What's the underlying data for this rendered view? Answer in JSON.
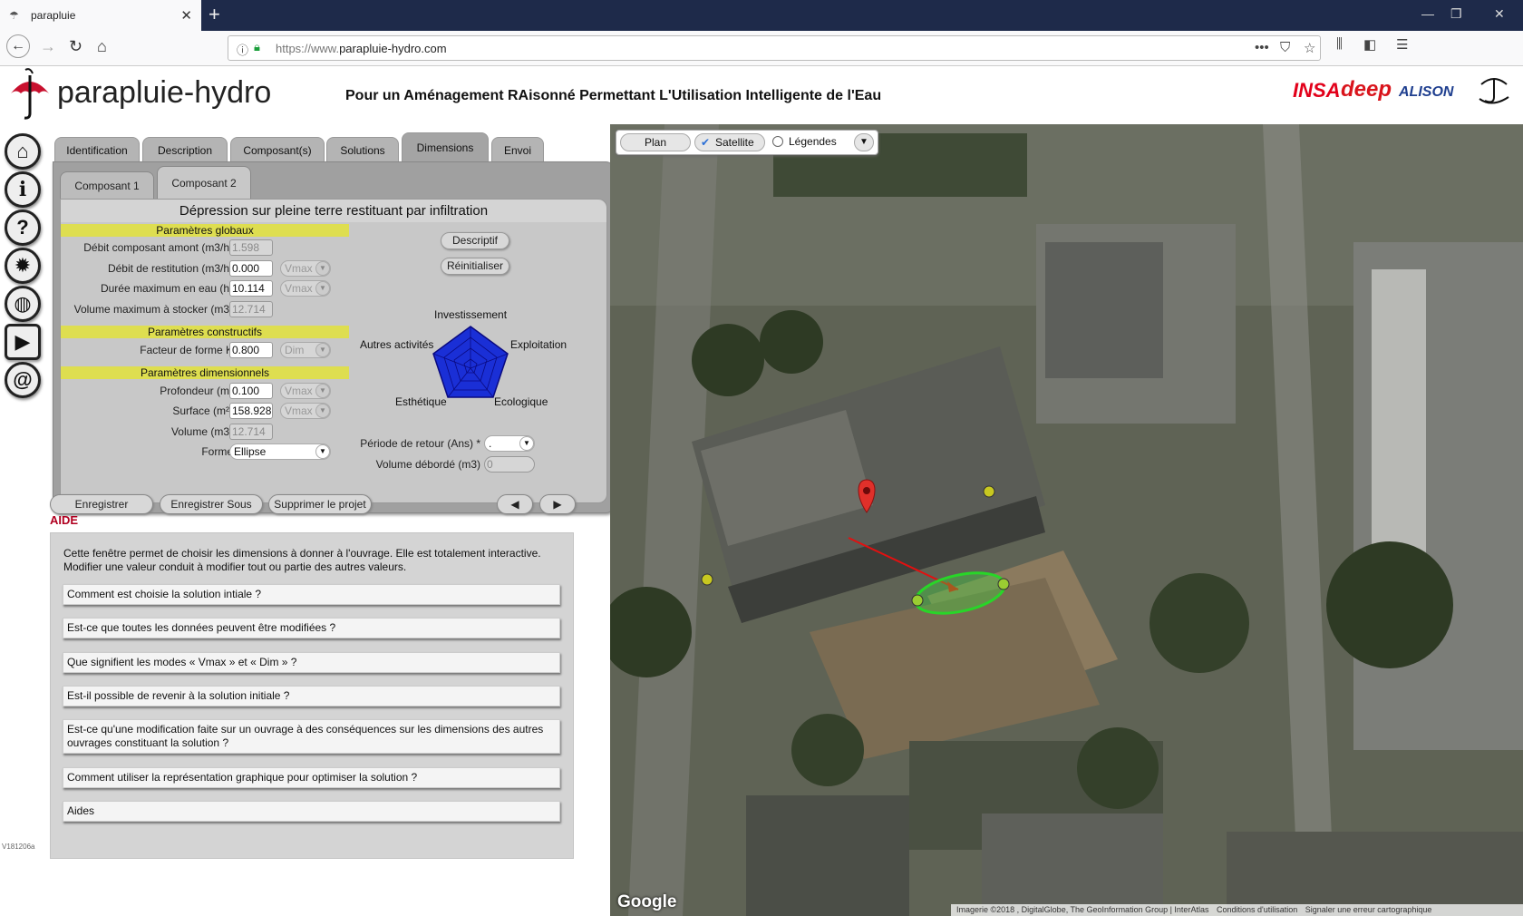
{
  "browser": {
    "tab_title": "parapluie",
    "url_prefix": "https://www.",
    "url_domain": "parapluie-hydro.com"
  },
  "header": {
    "app_title": "parapluie-hydro",
    "tagline": "Pour un Aménagement RAisonné Permettant L'Utilisation Intelligente de l'Eau",
    "partners": [
      "INSA",
      "deep",
      "ALISON"
    ]
  },
  "sidebar": {
    "icons": [
      "home-icon",
      "info-icon",
      "help-icon",
      "lightbulb-icon",
      "globe-icon",
      "video-icon",
      "at-icon"
    ]
  },
  "tabs": [
    {
      "label": "Identification",
      "active": false
    },
    {
      "label": "Description",
      "active": false
    },
    {
      "label": "Composant(s)",
      "active": false
    },
    {
      "label": "Solutions",
      "active": false
    },
    {
      "label": "Dimensions",
      "active": true
    },
    {
      "label": "Envoi",
      "active": false
    }
  ],
  "subtabs": [
    {
      "label": "Composant 1",
      "active": false
    },
    {
      "label": "Composant 2",
      "active": true
    }
  ],
  "form": {
    "title": "Dépression sur pleine terre restituant par infiltration",
    "sections": {
      "global": "Paramètres globaux",
      "constructive": "Paramètres constructifs",
      "dimensional": "Paramètres dimensionnels"
    },
    "fields": {
      "debit_amont": {
        "label": "Débit composant amont (m3/h)",
        "value": "1.598"
      },
      "debit_restitution": {
        "label": "Débit de restitution (m3/h)",
        "value": "0.000",
        "mode": "Vmax"
      },
      "duree_max": {
        "label": "Durée maximum en eau (h)",
        "value": "10.114",
        "mode": "Vmax"
      },
      "volume_max": {
        "label": "Volume maximum à stocker (m3)",
        "value": "12.714"
      },
      "facteur_forme": {
        "label": "Facteur de forme K",
        "value": "0.800",
        "mode": "Dim"
      },
      "profondeur": {
        "label": "Profondeur (m)",
        "value": "0.100",
        "mode": "Vmax"
      },
      "surface": {
        "label": "Surface (m²)",
        "value": "158.928",
        "mode": "Vmax"
      },
      "volume": {
        "label": "Volume (m3)",
        "value": "12.714"
      },
      "forme": {
        "label": "Forme",
        "value": "Ellipse"
      },
      "periode_retour": {
        "label": "Période de retour (Ans) *",
        "value": "."
      },
      "volume_deborde": {
        "label": "Volume débordé (m3)",
        "value": "0"
      }
    },
    "buttons": {
      "descriptif": "Descriptif",
      "reinitialiser": "Réinitialiser"
    },
    "radar": {
      "axes": [
        "Investissement",
        "Exploitation",
        "Ecologique",
        "Esthétique",
        "Autres activités"
      ],
      "fill_color": "#1a2fd6"
    }
  },
  "actions": {
    "enregistrer": "Enregistrer",
    "enregistrer_sous": "Enregistrer Sous",
    "supprimer": "Supprimer le projet",
    "prev": "◀",
    "next": "▶"
  },
  "aide": {
    "title": "AIDE",
    "intro": "Cette fenêtre permet de choisir les dimensions à donner à l'ouvrage. Elle est totalement interactive. Modifier une valeur conduit à modifier tout ou partie des autres valeurs.",
    "faq": [
      "Comment est choisie la solution intiale ?",
      "Est-ce que toutes les données peuvent être modifiées ?",
      "Que signifient les modes « Vmax » et « Dim » ?",
      "Est-il possible de revenir à la solution initiale ?",
      "Est-ce qu'une modification faite sur un ouvrage à des conséquences sur les dimensions des autres ouvrages constituant la solution ?",
      "Comment utiliser la représentation graphique pour optimiser la solution ?",
      "Aides"
    ]
  },
  "version": "V181206a",
  "map": {
    "plan": "Plan",
    "satellite": "Satellite",
    "legendes": "Légendes",
    "google": "Google",
    "footer": [
      "Imagerie ©2018 , DigitalGlobe, The GeoInformation Group | InterAtlas",
      "Conditions d'utilisation",
      "Signaler une erreur cartographique"
    ]
  }
}
